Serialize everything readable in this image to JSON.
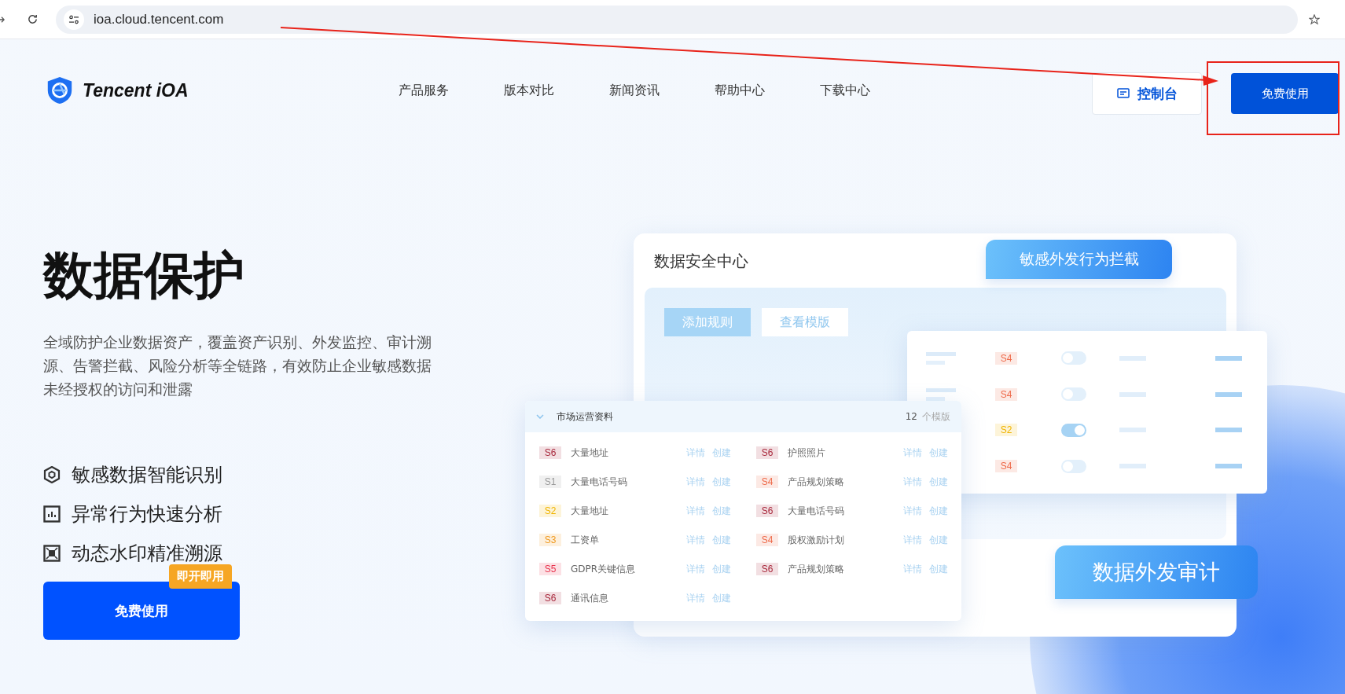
{
  "browser": {
    "url": "ioa.cloud.tencent.com"
  },
  "header": {
    "logo_text": "Tencent iOA",
    "nav": [
      "产品服务",
      "版本对比",
      "新闻资讯",
      "帮助中心",
      "下载中心"
    ],
    "console_button": "控制台",
    "cta_button": "免费使用"
  },
  "hero": {
    "title": "数据保护",
    "description": "全域防护企业数据资产，覆盖资产识别、外发监控、审计溯源、告警拦截、风险分析等全链路，有效防止企业敏感数据未经授权的访问和泄露",
    "features": [
      {
        "kind": "hexagon",
        "label": "敏感数据智能识别"
      },
      {
        "kind": "chart",
        "label": "异常行为快速分析"
      },
      {
        "kind": "focus",
        "label": "动态水印精准溯源"
      }
    ],
    "cta": {
      "label": "免费使用",
      "badge": "即开即用"
    }
  },
  "mockup": {
    "title": "数据安全中心",
    "callouts": [
      "敏感外发行为拦截",
      "数据外发审计"
    ],
    "buttons": [
      {
        "label": "添加规则",
        "kind": "primary"
      },
      {
        "label": "查看模版",
        "kind": "secondary"
      }
    ],
    "rules": [
      {
        "level": "S4",
        "color": "#ee6a4a",
        "on": false
      },
      {
        "level": "S4",
        "color": "#ee6a4a",
        "on": false
      },
      {
        "level": "S2",
        "color": "#f0b400",
        "on": true
      },
      {
        "level": "S4",
        "color": "#ee6a4a",
        "on": false
      }
    ],
    "templates": {
      "group": "市场运营资料",
      "count": "12",
      "count_unit": "个模版",
      "items": [
        {
          "level": "S6",
          "color": "#a8283c",
          "name": "大量地址",
          "detail": "详情",
          "create": "创建"
        },
        {
          "level": "S6",
          "color": "#a8283c",
          "name": "护照照片",
          "detail": "详情",
          "create": "创建"
        },
        {
          "level": "S1",
          "color": "#9a9a9a",
          "name": "大量电话号码",
          "detail": "详情",
          "create": "创建"
        },
        {
          "level": "S4",
          "color": "#ee6a4a",
          "name": "产品规划策略",
          "detail": "详情",
          "create": "创建"
        },
        {
          "level": "S2",
          "color": "#f0b400",
          "name": "大量地址",
          "detail": "详情",
          "create": "创建"
        },
        {
          "level": "S6",
          "color": "#a8283c",
          "name": "大量电话号码",
          "detail": "详情",
          "create": "创建"
        },
        {
          "level": "S3",
          "color": "#f09a20",
          "name": "工资单",
          "detail": "详情",
          "create": "创建"
        },
        {
          "level": "S4",
          "color": "#ee6a4a",
          "name": "股权激励计划",
          "detail": "详情",
          "create": "创建"
        },
        {
          "level": "S5",
          "color": "#e8344e",
          "name": "GDPR关键信息",
          "detail": "详情",
          "create": "创建"
        },
        {
          "level": "S6",
          "color": "#a8283c",
          "name": "产品规划策略",
          "detail": "详情",
          "create": "创建"
        },
        {
          "level": "S6",
          "color": "#a8283c",
          "name": "通讯信息",
          "detail": "详情",
          "create": "创建"
        }
      ]
    }
  }
}
